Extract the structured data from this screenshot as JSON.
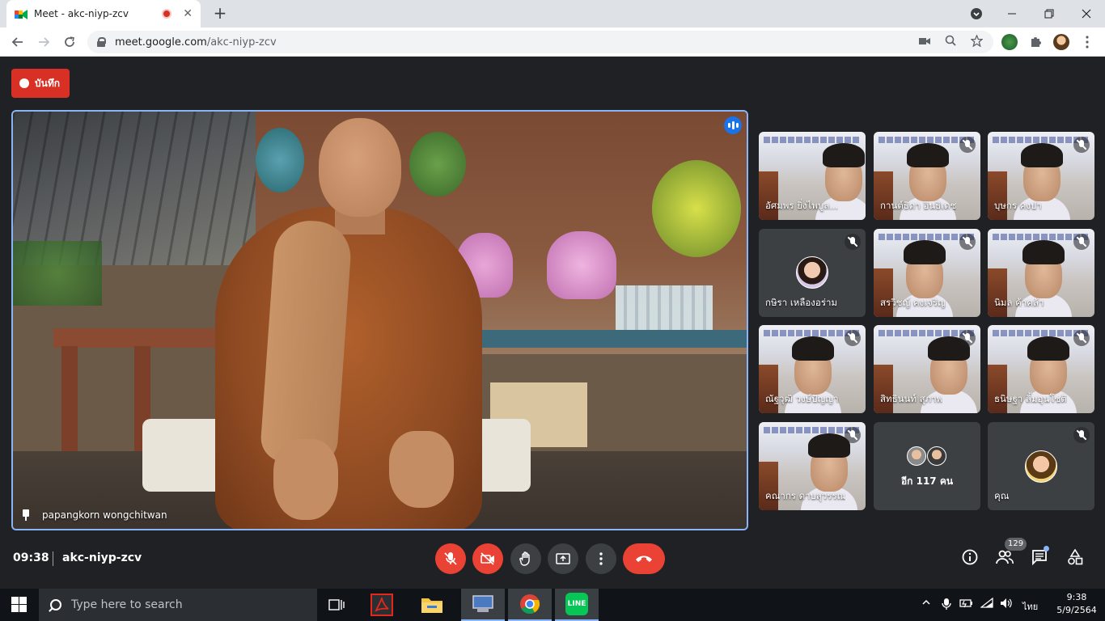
{
  "browser": {
    "tab_title": "Meet - akc-niyp-zcv",
    "tab_close": "✕",
    "new_tab": "+",
    "url_host": "meet.google.com",
    "url_path": "/akc-niyp-zcv"
  },
  "meet": {
    "record_label": "บันทึก",
    "main_participant": "papangkorn wongchitwan",
    "meeting_time": "09:38",
    "meeting_code": "akc-niyp-zcv",
    "participant_count": "129",
    "tiles": [
      {
        "name": "อัศมพร ยิ่งไพบูล...",
        "type": "video",
        "muted": false
      },
      {
        "name": "กานต์ธิดา อินธิเดช",
        "type": "video",
        "muted": true
      },
      {
        "name": "บุษกร คงปา",
        "type": "video",
        "muted": true
      },
      {
        "name": "กษิรา เหลืองอร่าม",
        "type": "avatar",
        "muted": true
      },
      {
        "name": "สรวิชญ์ คงเจริญ",
        "type": "video",
        "muted": true
      },
      {
        "name": "นิมล ค้าคล้า",
        "type": "video",
        "muted": true
      },
      {
        "name": "ณัฐวุฒิ วงษ์ปัญญา",
        "type": "video",
        "muted": true
      },
      {
        "name": "สิทธินนท์ สุภาพ",
        "type": "video",
        "muted": true
      },
      {
        "name": "ธนิษฐา ลิ้มอุนโชติ",
        "type": "video",
        "muted": true
      },
      {
        "name": "คณากร ดาบสุวรรณ",
        "type": "video",
        "muted": true
      },
      {
        "name": "อีก 117 คน",
        "type": "more",
        "muted": false
      },
      {
        "name": "คุณ",
        "type": "self",
        "muted": true
      }
    ]
  },
  "taskbar": {
    "search_placeholder": "Type here to search",
    "lang": "ไทย",
    "time": "9:38",
    "date": "5/9/2564",
    "line_label": "LINE"
  },
  "colors": {
    "meet_bg": "#202124",
    "end_call": "#ea4335",
    "active_border": "#8ab4f8",
    "record": "#d93025"
  }
}
